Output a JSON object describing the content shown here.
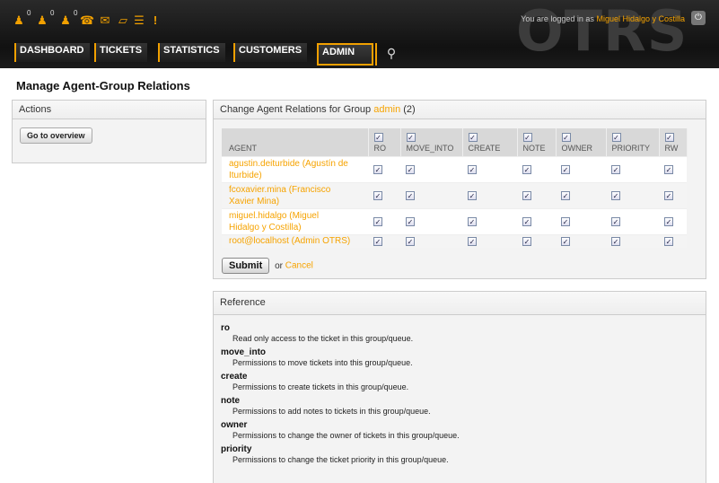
{
  "header": {
    "logo": "OTRS",
    "login_prefix": "You are logged in as",
    "login_user": "Miguel Hidalgo y Costilla",
    "toolbar_counts": [
      "0",
      "0",
      "0"
    ],
    "toolbar_icons": [
      "locked-tickets-icon",
      "watched-tickets-icon",
      "responsible-tickets-icon",
      "phone-ticket-icon",
      "email-ticket-icon",
      "ticket-search-icon",
      "queue-view-icon",
      "escalation-icon"
    ]
  },
  "nav": {
    "items": [
      "DASHBOARD",
      "TICKETS",
      "STATISTICS",
      "CUSTOMERS",
      "ADMIN"
    ],
    "selected": "ADMIN"
  },
  "page_title": "Manage Agent-Group Relations",
  "sidebar": {
    "title": "Actions",
    "go_overview": "Go to overview"
  },
  "main": {
    "title_prefix": "Change Agent Relations for Group",
    "group_name": "admin",
    "title_suffix": "(2)",
    "columns": [
      "AGENT",
      "RO",
      "MOVE_INTO",
      "CREATE",
      "NOTE",
      "OWNER",
      "PRIORITY",
      "RW"
    ],
    "rows": [
      {
        "agent_line1": "agustin.deiturbide (Agustín de",
        "agent_line2": "Iturbide)"
      },
      {
        "agent_line1": "fcoxavier.mina (Francisco",
        "agent_line2": "Xavier Mina)"
      },
      {
        "agent_line1": "miguel.hidalgo (Miguel",
        "agent_line2": "Hidalgo y Costilla)"
      },
      {
        "agent_line1": "root@localhost (Admin OTRS)",
        "agent_line2": ""
      }
    ],
    "submit_label": "Submit",
    "or_text": "or",
    "cancel_label": "Cancel"
  },
  "reference": {
    "title": "Reference",
    "items": [
      {
        "term": "ro",
        "desc": "Read only access to the ticket in this group/queue."
      },
      {
        "term": "move_into",
        "desc": "Permissions to move tickets into this group/queue."
      },
      {
        "term": "create",
        "desc": "Permissions to create tickets in this group/queue."
      },
      {
        "term": "note",
        "desc": "Permissions to add notes to tickets in this group/queue."
      },
      {
        "term": "owner",
        "desc": "Permissions to change the owner of tickets in this group/queue."
      },
      {
        "term": "priority",
        "desc": "Permissions to change the ticket priority in this group/queue."
      }
    ]
  },
  "colors": {
    "accent": "#f6a300",
    "header_bg": "#1b1b1b"
  }
}
